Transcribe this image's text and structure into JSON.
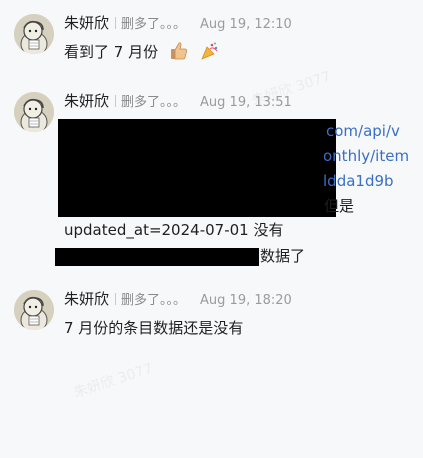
{
  "watermark": "朱妍欣 3077",
  "messages": [
    {
      "sender": "朱妍欣",
      "status": "删多了。。。",
      "time": "Aug 19, 12:10",
      "text": "看到了 7 月份",
      "emojis": [
        "thumbs-up",
        "party-popper"
      ]
    },
    {
      "sender": "朱妍欣",
      "status": "删多了。。。",
      "time": "Aug 19, 13:51",
      "link_line_1": "com/api/v",
      "link_line_2": "onthly/item",
      "link_line_3": "ldda1d9b",
      "text_after_link": "但是",
      "text_line_4": "updated_at=2024-07-01 没有",
      "text_line_5": "数据了"
    },
    {
      "sender": "朱妍欣",
      "status": "删多了。。。",
      "time": "Aug 19, 18:20",
      "text": "7 月份的条目数据还是没有"
    }
  ],
  "colors": {
    "background": "#f7f8fa",
    "link": "#3a6fc4",
    "redaction": "#000000"
  }
}
